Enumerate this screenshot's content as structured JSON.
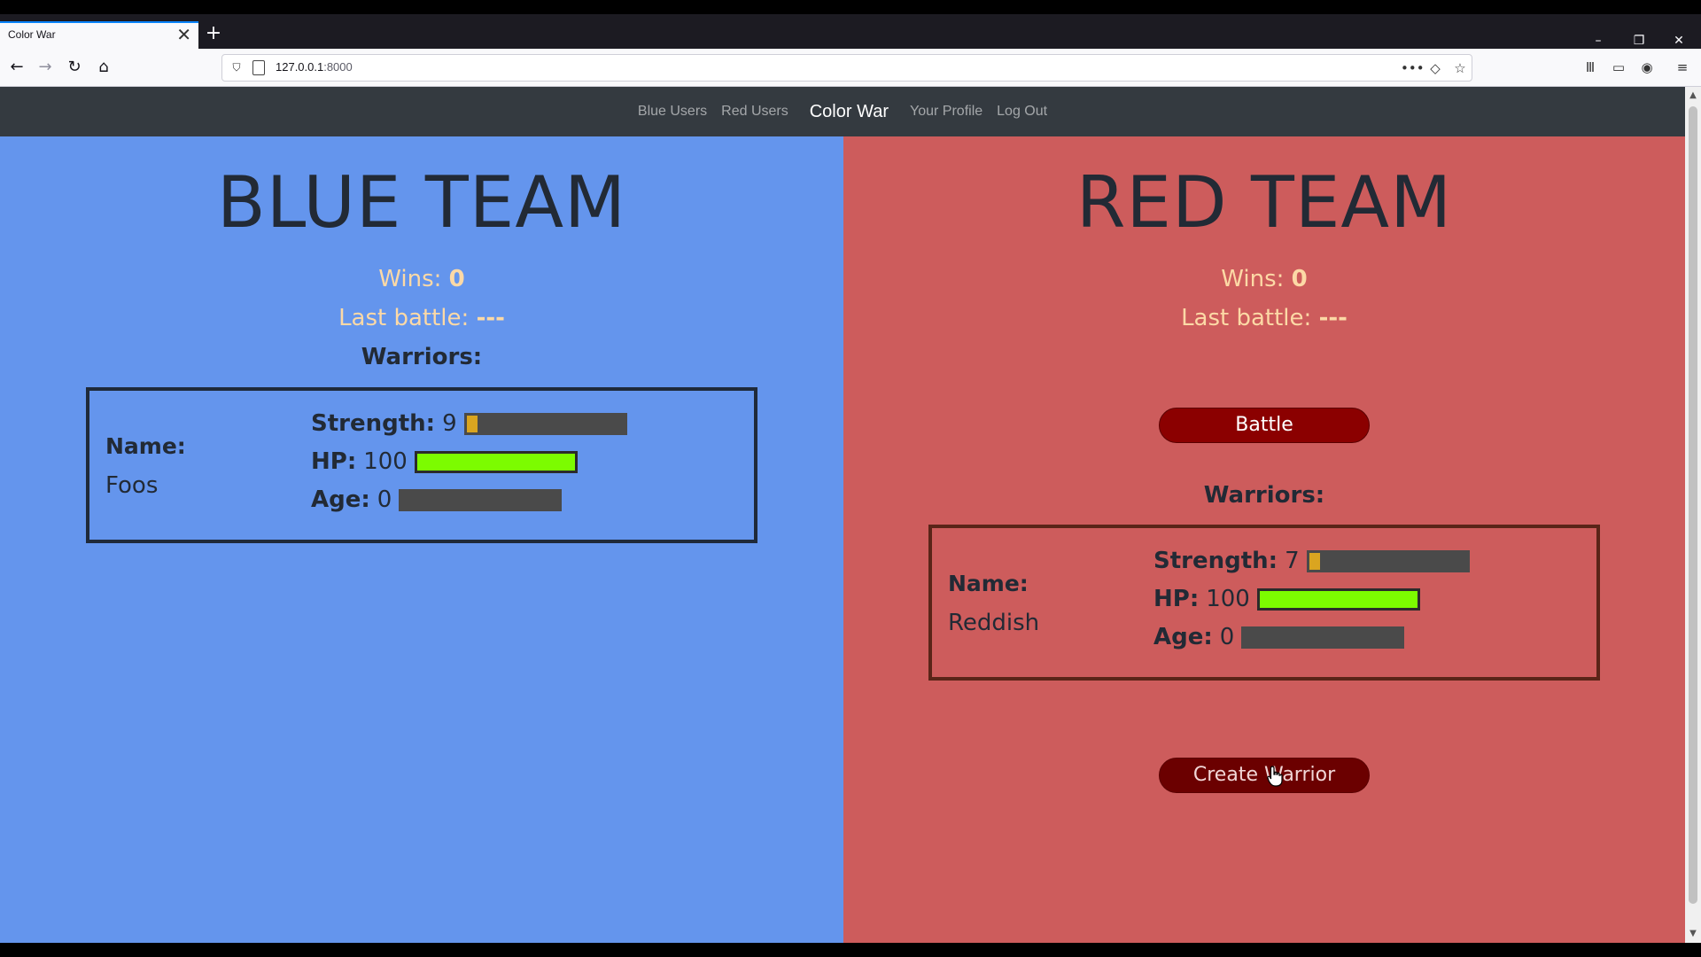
{
  "browser": {
    "tab_title": "Color War",
    "tab_close": "✕",
    "new_tab": "+",
    "url_host": "127.0.0.1",
    "url_port": ":8000",
    "window_controls": {
      "minimize": "–",
      "restore": "❐",
      "close": "✕"
    },
    "nav_icons": {
      "back": "←",
      "forward": "→",
      "reload": "↻",
      "home": "⌂"
    },
    "url_icons": {
      "more": "•••",
      "pocket": "◇",
      "bookmark": "☆"
    },
    "toolbar_icons": {
      "library": "Ⅲ",
      "sidebar": "▭",
      "account": "◉",
      "menu": "≡"
    }
  },
  "site_nav": {
    "links": [
      "Blue Users",
      "Red Users"
    ],
    "brand": "Color War",
    "links_right": [
      "Your Profile",
      "Log Out"
    ]
  },
  "blue_team": {
    "title": "BLUE TEAM",
    "wins_label": "Wins:",
    "wins_value": "0",
    "last_battle_label": "Last battle:",
    "last_battle_value": "---",
    "warriors_heading": "Warriors:",
    "warriors": [
      {
        "name_label": "Name:",
        "name": "Foos",
        "strength_label": "Strength:",
        "strength": "9",
        "hp_label": "HP:",
        "hp": "100",
        "age_label": "Age:",
        "age": "0",
        "strength_fraction": 0.1,
        "hp_fraction": 1.0,
        "age_fraction": 0.0
      }
    ]
  },
  "red_team": {
    "title": "RED TEAM",
    "wins_label": "Wins:",
    "wins_value": "0",
    "last_battle_label": "Last battle:",
    "last_battle_value": "---",
    "battle_button": "Battle",
    "warriors_heading": "Warriors:",
    "warriors": [
      {
        "name_label": "Name:",
        "name": "Reddish",
        "strength_label": "Strength:",
        "strength": "7",
        "hp_label": "HP:",
        "hp": "100",
        "age_label": "Age:",
        "age": "0",
        "strength_fraction": 0.08,
        "hp_fraction": 1.0,
        "age_fraction": 0.0
      }
    ],
    "create_button": "Create Warrior"
  },
  "colors": {
    "blue_bg": "#6495ed",
    "red_bg": "#cd5c5c",
    "accent_text": "#fcd9a6",
    "strength_bar": "#daa520",
    "hp_bar": "#7cfc00",
    "button": "#8b0000"
  }
}
